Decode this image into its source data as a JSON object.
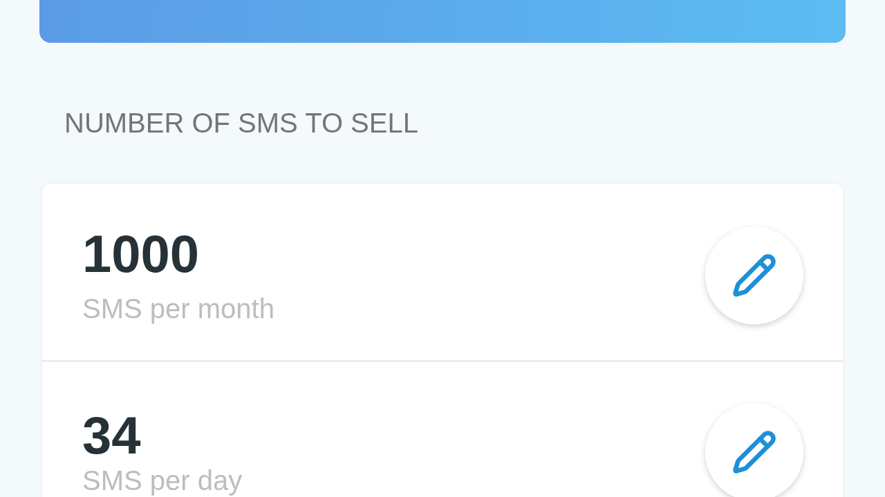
{
  "section_title": "NUMBER OF SMS TO SELL",
  "items": [
    {
      "value": "1000",
      "label": "SMS per month"
    },
    {
      "value": "34",
      "label": "SMS per day"
    }
  ]
}
